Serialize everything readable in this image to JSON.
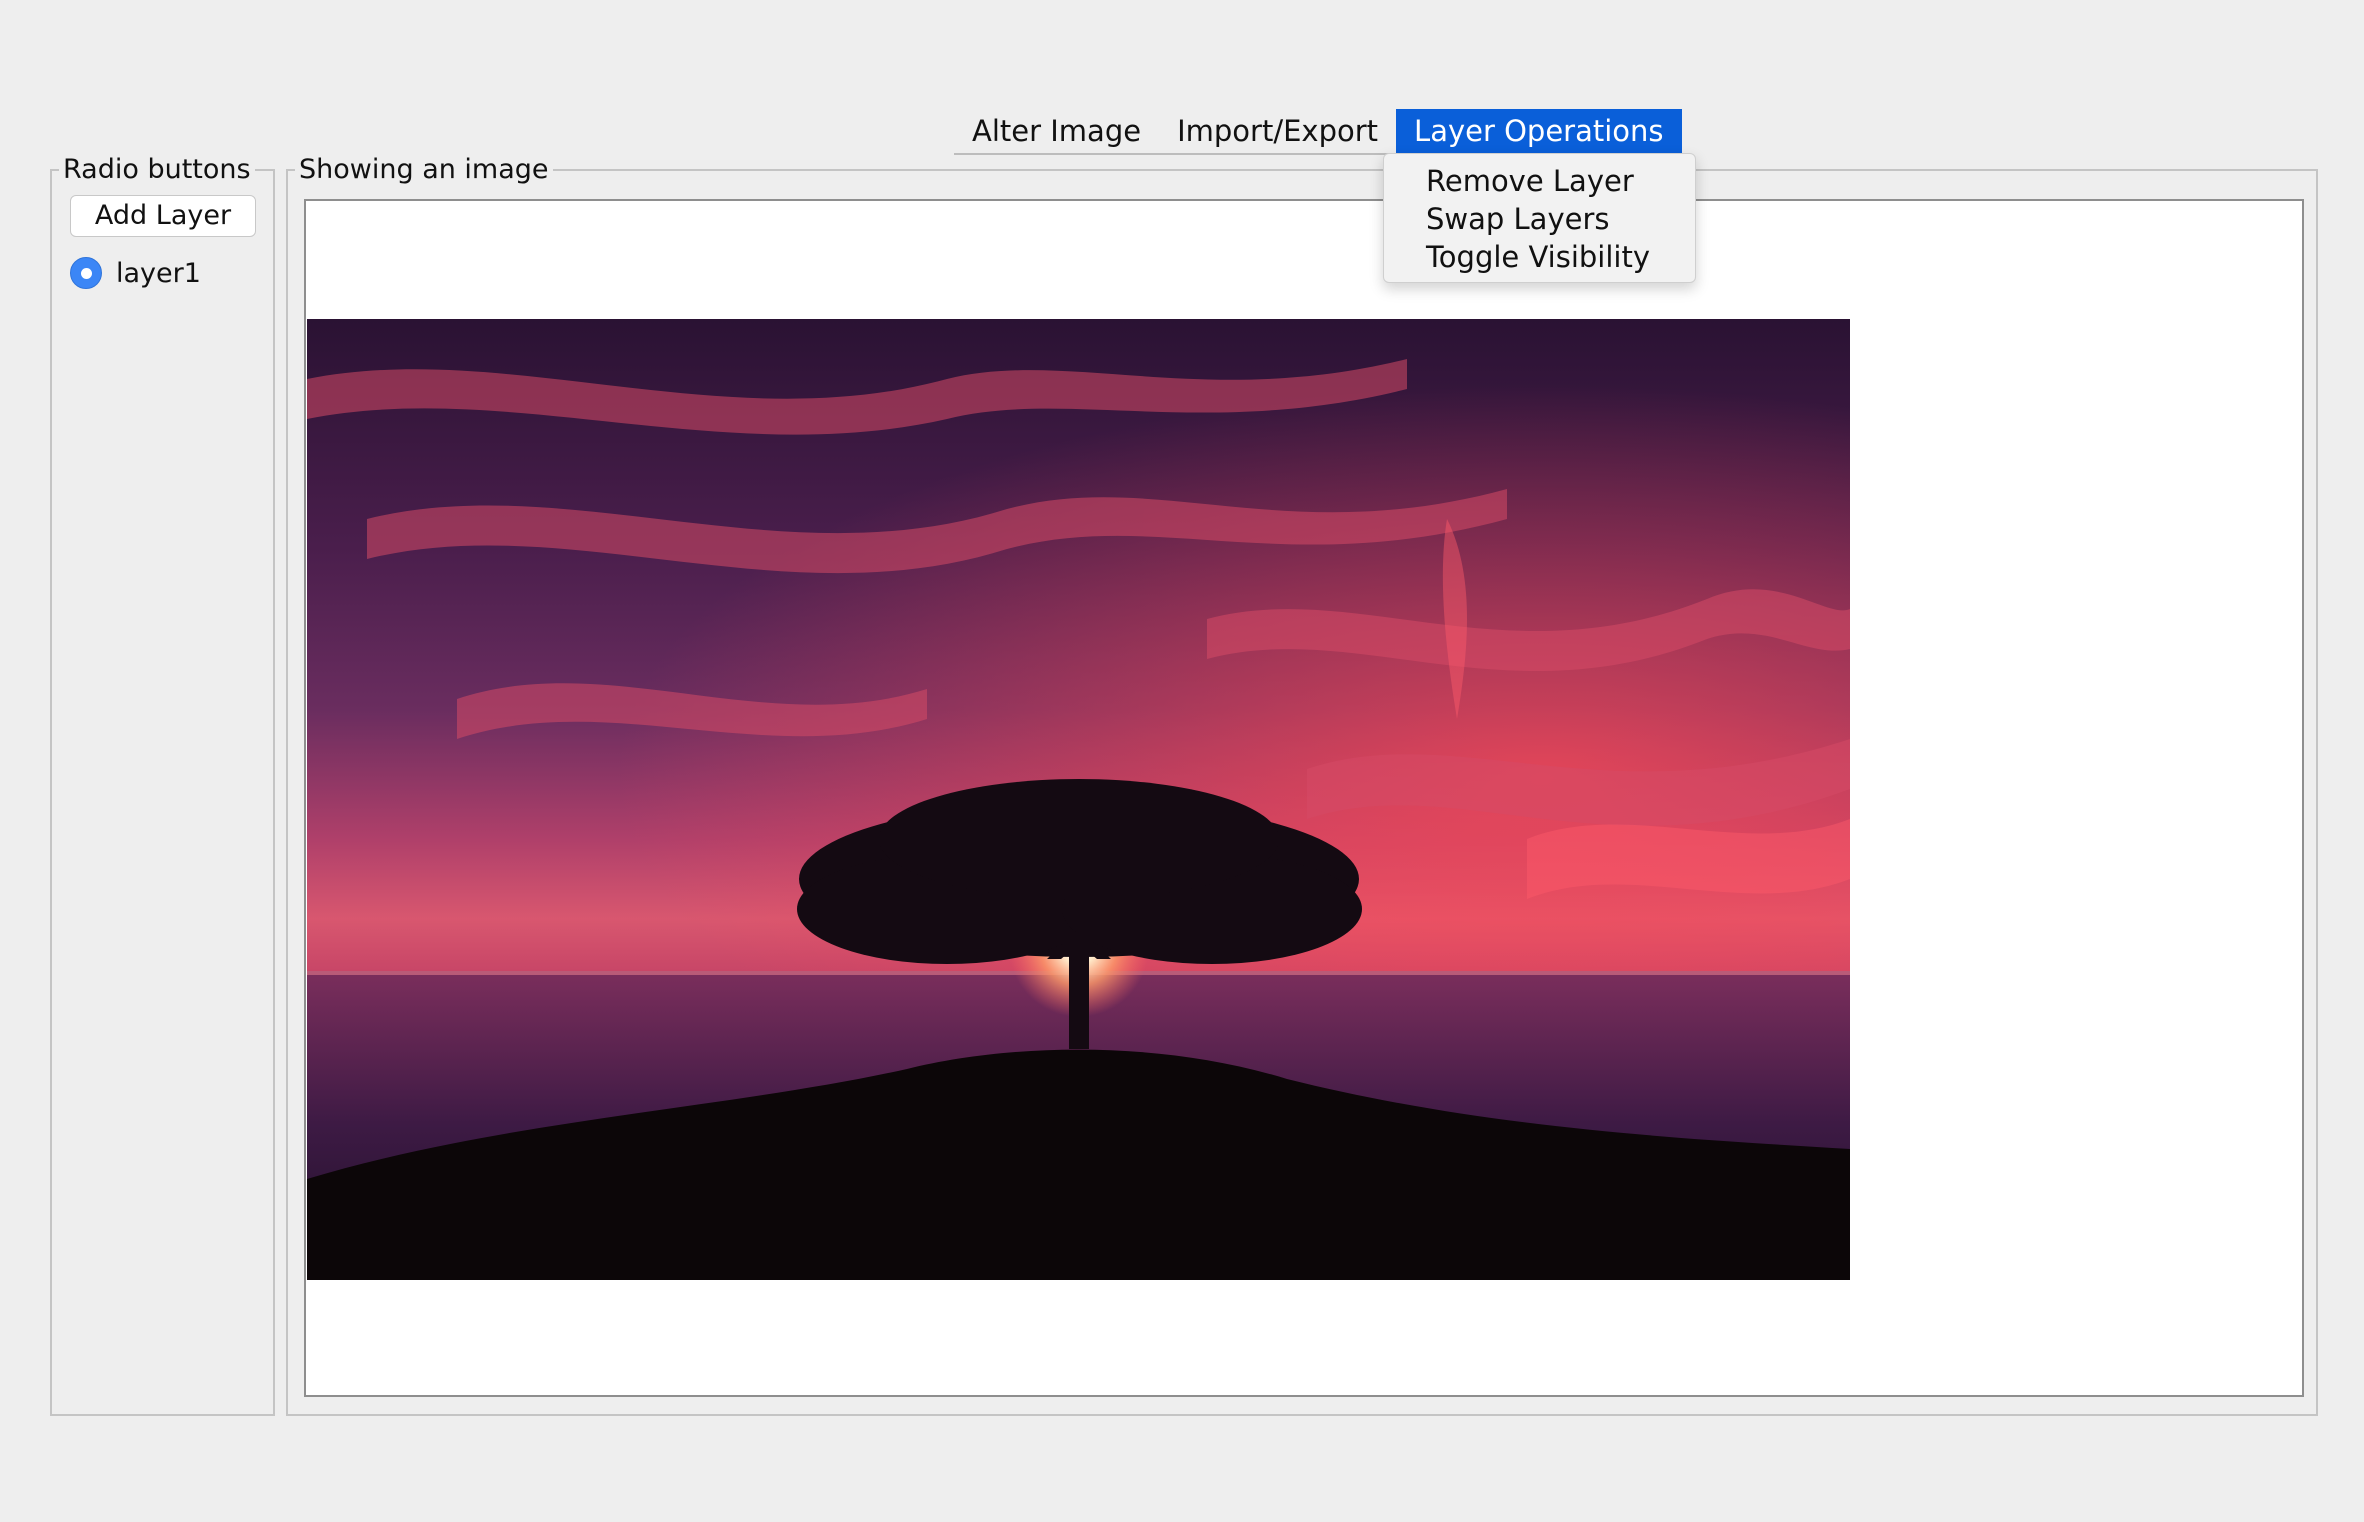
{
  "menubar": {
    "items": [
      {
        "label": "Alter Image"
      },
      {
        "label": "Import/Export"
      },
      {
        "label": "Layer Operations",
        "active": true
      }
    ]
  },
  "dropdown": {
    "items": [
      {
        "label": "Remove Layer"
      },
      {
        "label": "Swap Layers"
      },
      {
        "label": "Toggle Visibility"
      }
    ]
  },
  "left_panel": {
    "legend": "Radio buttons",
    "add_button": "Add Layer",
    "layers": [
      {
        "label": "layer1",
        "selected": true
      }
    ]
  },
  "image_panel": {
    "legend": "Showing an image",
    "image_description": "sunset-tree-silhouette"
  },
  "colors": {
    "accent": "#0a5fd9",
    "radio": "#3b86f6",
    "background": "#eeeeee"
  }
}
